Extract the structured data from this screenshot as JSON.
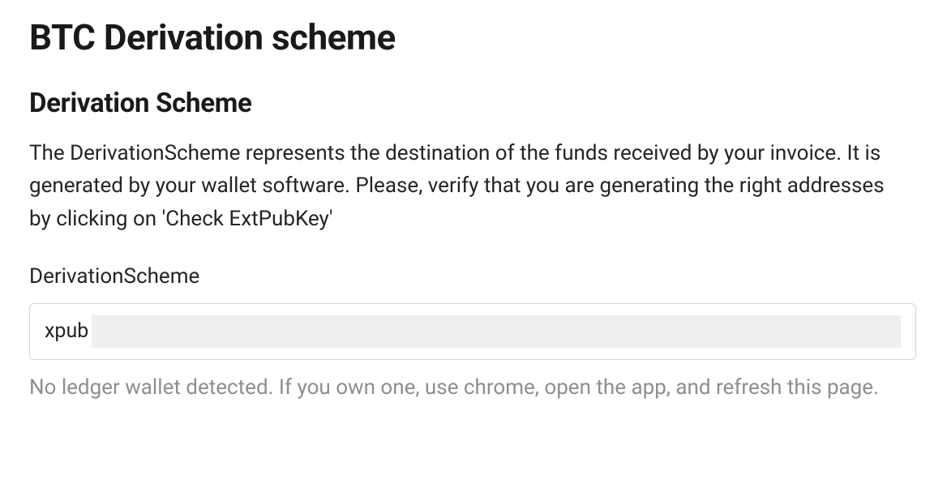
{
  "page": {
    "title": "BTC Derivation scheme",
    "section_heading": "Derivation Scheme",
    "description": "The DerivationScheme represents the destination of the funds received by your invoice. It is generated by your wallet software. Please, verify that you are generating the right addresses by clicking on 'Check ExtPubKey'",
    "form": {
      "label": "DerivationScheme",
      "value": "xpub"
    },
    "hint": "No ledger wallet detected. If you own one, use chrome, open the app, and refresh this page."
  }
}
